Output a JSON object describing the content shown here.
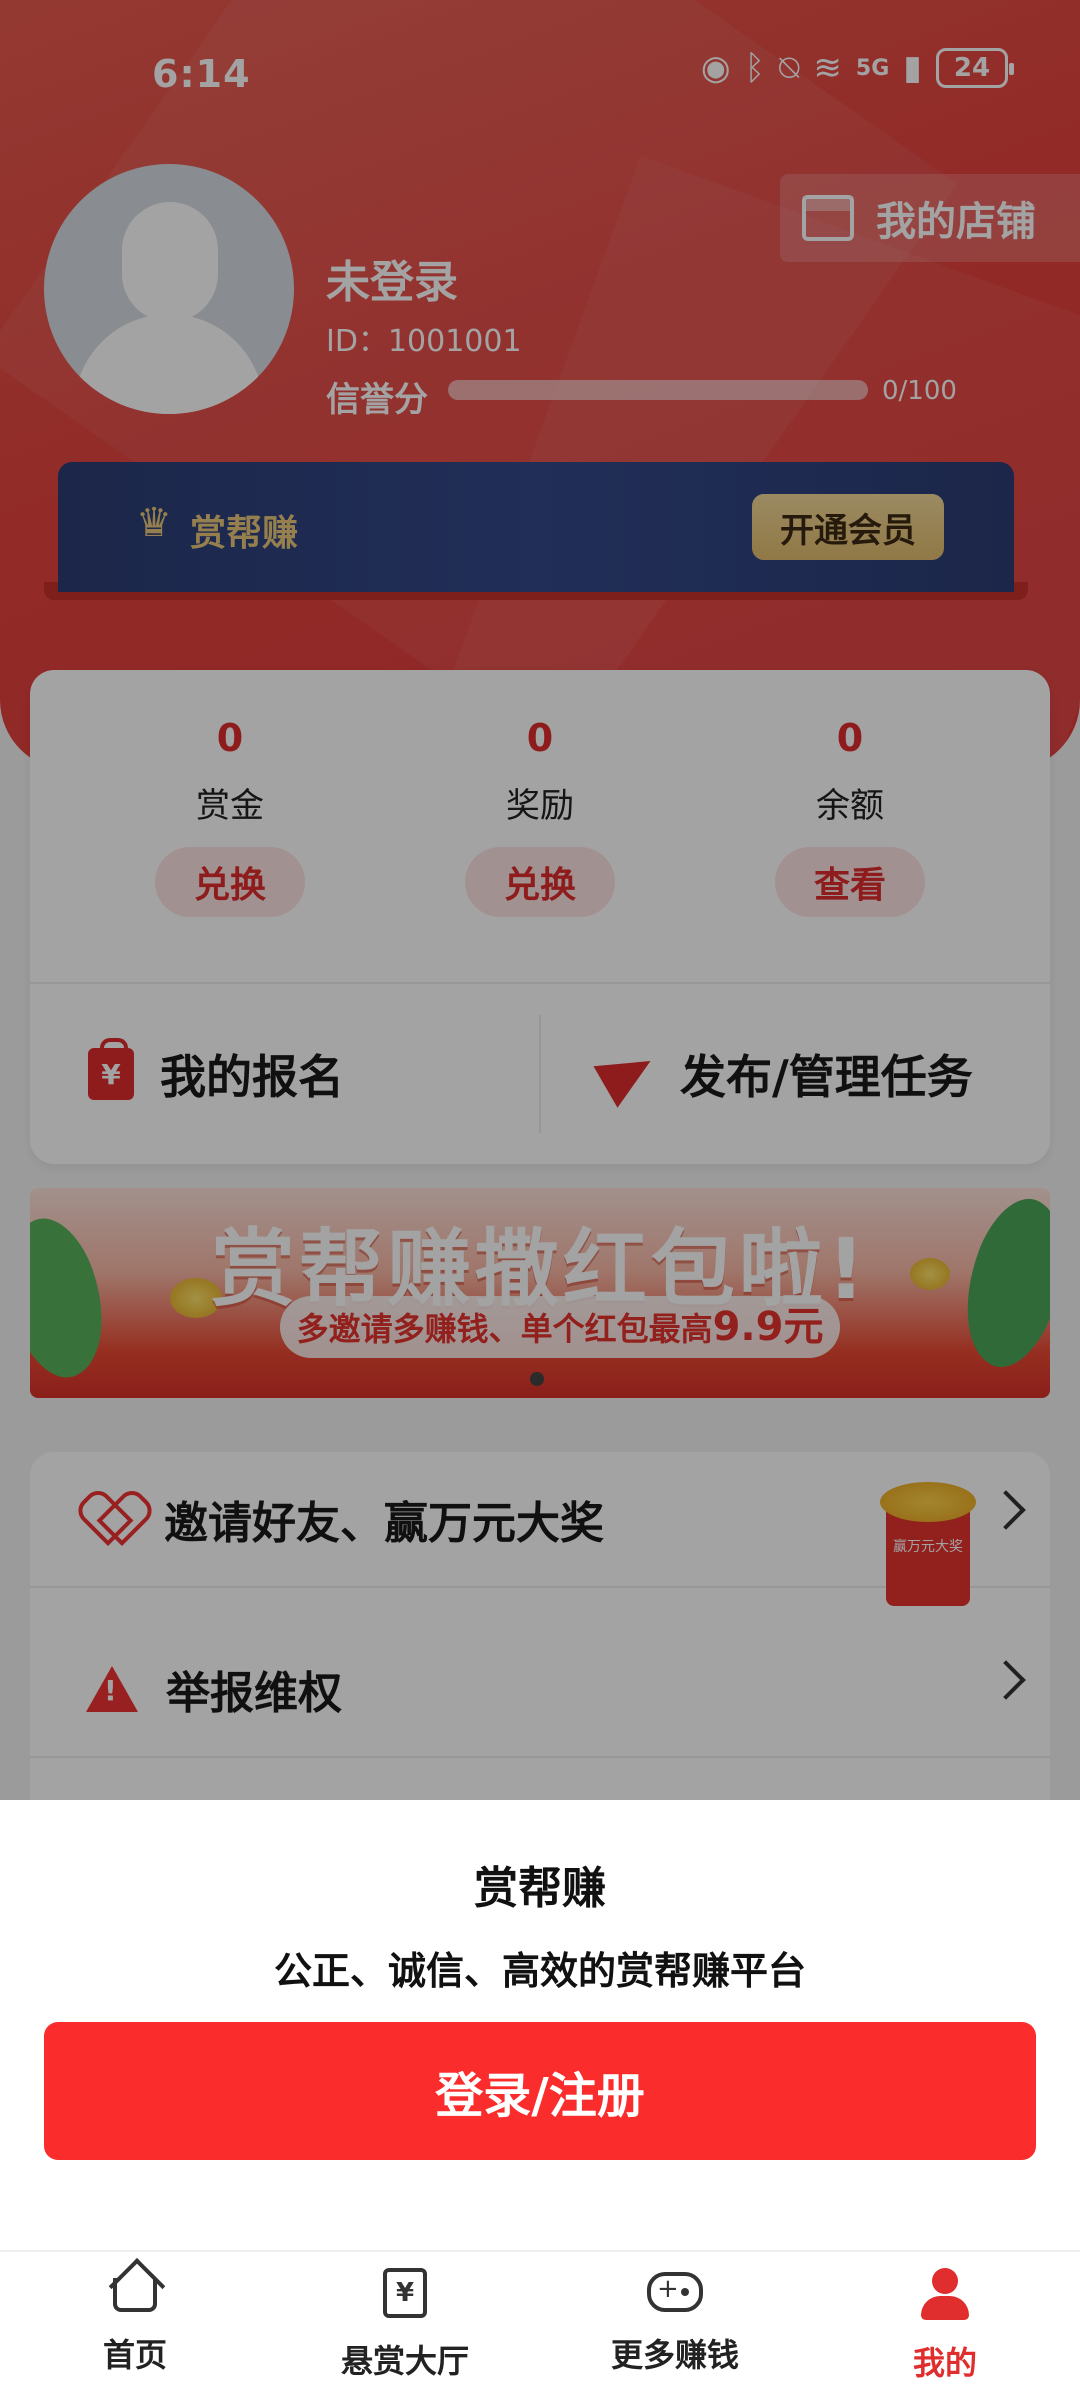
{
  "status_bar": {
    "time": "6:14",
    "battery": "24",
    "network": "5G",
    "icons": [
      "eye-icon",
      "bluetooth-icon",
      "mute-bell-icon",
      "wifi-icon",
      "signal-icon",
      "battery-icon"
    ]
  },
  "profile": {
    "username": "未登录",
    "id": "ID：1001001",
    "credit_label": "信誉分",
    "credit_value": "0/100",
    "credit_progress": 0
  },
  "shop": {
    "label": "我的店铺",
    "icon": "shop-icon"
  },
  "vip": {
    "crown": "♛",
    "brand": "赏帮赚",
    "button": "开通会员"
  },
  "stats": [
    {
      "value": "0",
      "label": "赏金",
      "button": "兑换"
    },
    {
      "value": "0",
      "label": "奖励",
      "button": "兑换"
    },
    {
      "value": "0",
      "label": "余额",
      "button": "查看"
    }
  ],
  "actions": {
    "signup": {
      "label": "我的报名",
      "icon": "bag-icon",
      "icon_char": "¥"
    },
    "publish": {
      "label": "发布/管理任务",
      "icon": "paper-plane-icon"
    }
  },
  "banner": {
    "title": "赏帮赚撒红包啦!",
    "subtitle_prefix": "多邀请多赚钱、单个红包最高",
    "subtitle_amount": "9.9元"
  },
  "menu": [
    {
      "label": "邀请好友、赢万元大奖",
      "icon": "heart-icon",
      "badge": "赢万元大奖"
    },
    {
      "label": "举报维权",
      "icon": "warning-icon"
    }
  ],
  "sheet": {
    "title": "赏帮赚",
    "subtitle": "公正、诚信、高效的赏帮赚平台",
    "login_button": "登录/注册"
  },
  "nav": [
    {
      "label": "首页",
      "icon": "home-icon",
      "active": false
    },
    {
      "label": "悬赏大厅",
      "icon": "reward-hall-icon",
      "icon_char": "¥",
      "active": false
    },
    {
      "label": "更多赚钱",
      "icon": "gamepad-icon",
      "active": false
    },
    {
      "label": "我的",
      "icon": "person-icon",
      "active": true
    }
  ],
  "colors": {
    "brand_red": "#e02d2d",
    "login_red": "#fb2c2c",
    "vip_navy": "#2b3c73",
    "vip_gold": "#e9c77a"
  }
}
